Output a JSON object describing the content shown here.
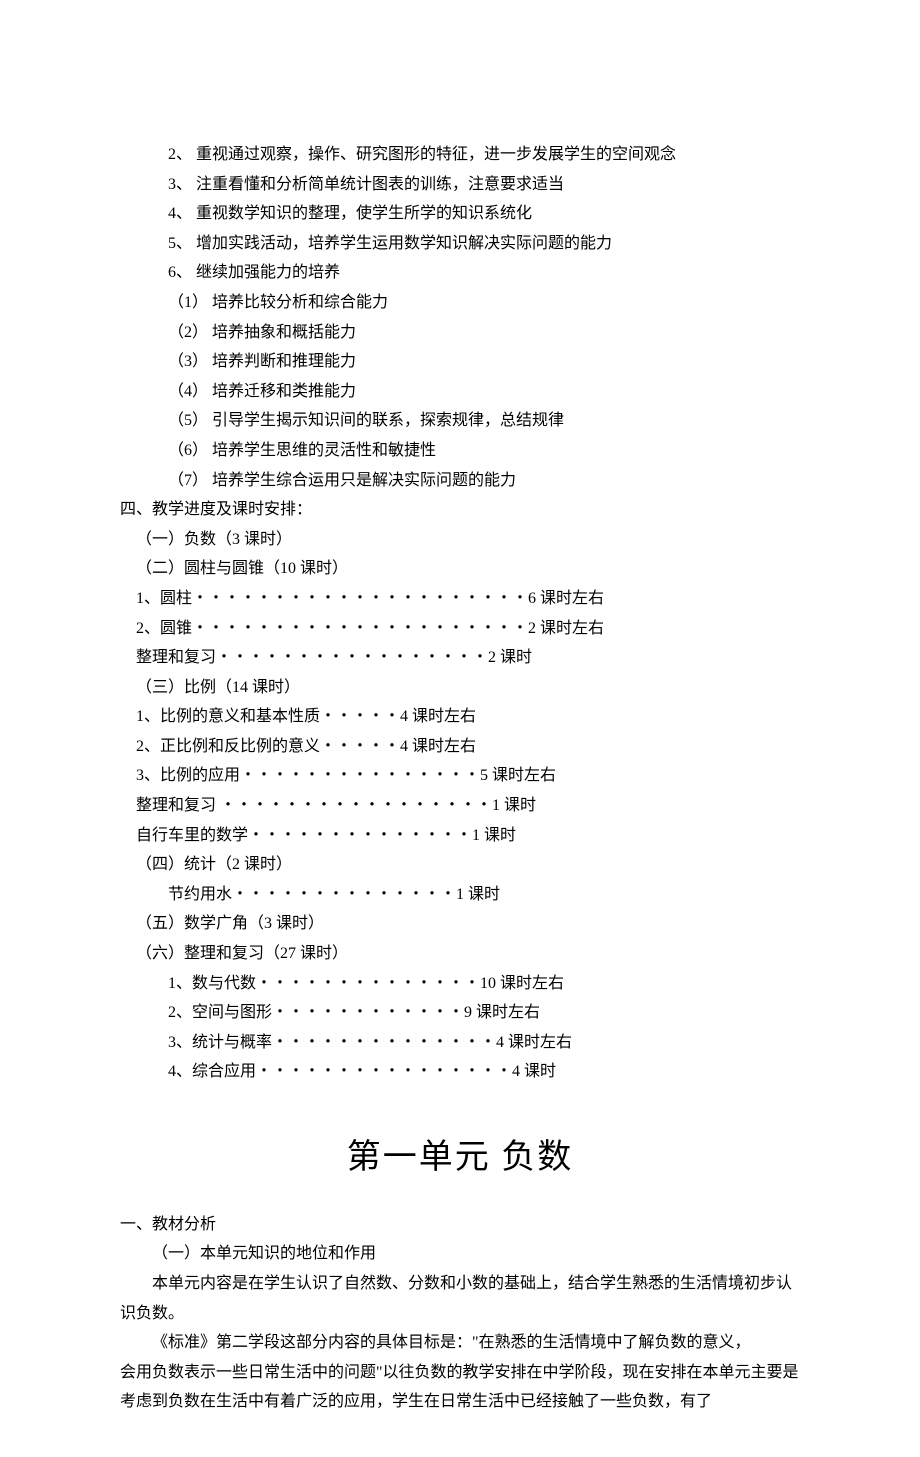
{
  "top": {
    "items": [
      "2、 重视通过观察，操作、研究图形的特征，进一步发展学生的空间观念",
      "3、 注重看懂和分析简单统计图表的训练，注意要求适当",
      "4、 重视数学知识的整理，使学生所学的知识系统化",
      "5、 增加实践活动，培养学生运用数学知识解决实际问题的能力",
      "6、 继续加强能力的培养",
      "（1） 培养比较分析和综合能力",
      "（2） 培养抽象和概括能力",
      "（3） 培养判断和推理能力",
      "（4） 培养迁移和类推能力",
      "（5） 引导学生揭示知识间的联系，探索规律，总结规律",
      "（6） 培养学生思维的灵活性和敏捷性",
      "（7） 培养学生综合运用只是解决实际问题的能力"
    ]
  },
  "sec4": {
    "heading": "四、教学进度及课时安排：",
    "lines": [
      {
        "cls": "indent-3",
        "text": "（一）负数（3 课时）"
      },
      {
        "cls": "indent-3",
        "text": "（二）圆柱与圆锥（10 课时）"
      },
      {
        "cls": "indent-3",
        "text": "1、圆柱・・・・・・・・・・・・・・・・・・・・・6 课时左右"
      },
      {
        "cls": "indent-3",
        "text": "2、圆锥・・・・・・・・・・・・・・・・・・・・・2 课时左右"
      },
      {
        "cls": "indent-3",
        "text": "整理和复习・・・・・・・・・・・・・・・・・2 课时"
      },
      {
        "cls": "indent-3",
        "text": "（三）比例（14 课时）"
      },
      {
        "cls": "indent-3",
        "text": "1、比例的意义和基本性质・・・・・4 课时左右"
      },
      {
        "cls": "indent-3",
        "text": "2、正比例和反比例的意义・・・・・4 课时左右"
      },
      {
        "cls": "indent-3",
        "text": "3、比例的应用・・・・・・・・・・・・・・・5 课时左右"
      },
      {
        "cls": "indent-3",
        "text": "整理和复习 ・・・・・・・・・・・・・・・・・1 课时"
      },
      {
        "cls": "indent-3",
        "text": "自行车里的数学・・・・・・・・・・・・・・1 课时"
      },
      {
        "cls": "indent-3",
        "text": "（四）统计（2 课时）"
      },
      {
        "cls": "indent-5",
        "text": "节约用水・・・・・・・・・・・・・・1 课时"
      },
      {
        "cls": "indent-3",
        "text": "（五）数学广角（3 课时）"
      },
      {
        "cls": "indent-3",
        "text": "（六）整理和复习（27 课时）"
      },
      {
        "cls": "indent-5",
        "text": "1、数与代数・・・・・・・・・・・・・・10 课时左右"
      },
      {
        "cls": "indent-5",
        "text": "2、空间与图形・・・・・・・・・・・・9 课时左右"
      },
      {
        "cls": "indent-5",
        "text": "3、统计与概率・・・・・・・・・・・・・・4 课时左右"
      },
      {
        "cls": "indent-5",
        "text": "4、综合应用・・・・・・・・・・・・・・・・4 课时"
      }
    ]
  },
  "unit": {
    "title": "第一单元      负数",
    "h1": "一、教材分析",
    "h2": "（一）本单元知识的地位和作用",
    "p1": "本单元内容是在学生认识了自然数、分数和小数的基础上，结合学生熟悉的生活情境初步认识负数。",
    "p2a": "《标准》第二学段这部分内容的具体目标是：\"在熟悉的生活情境中了解负数的意义，",
    "p2b": "会用负数表示一些日常生活中的问题\"以往负数的教学安排在中学阶段，现在安排在本单元主要是考虑到负数在生活中有着广泛的应用，学生在日常生活中已经接触了一些负数，有了"
  }
}
